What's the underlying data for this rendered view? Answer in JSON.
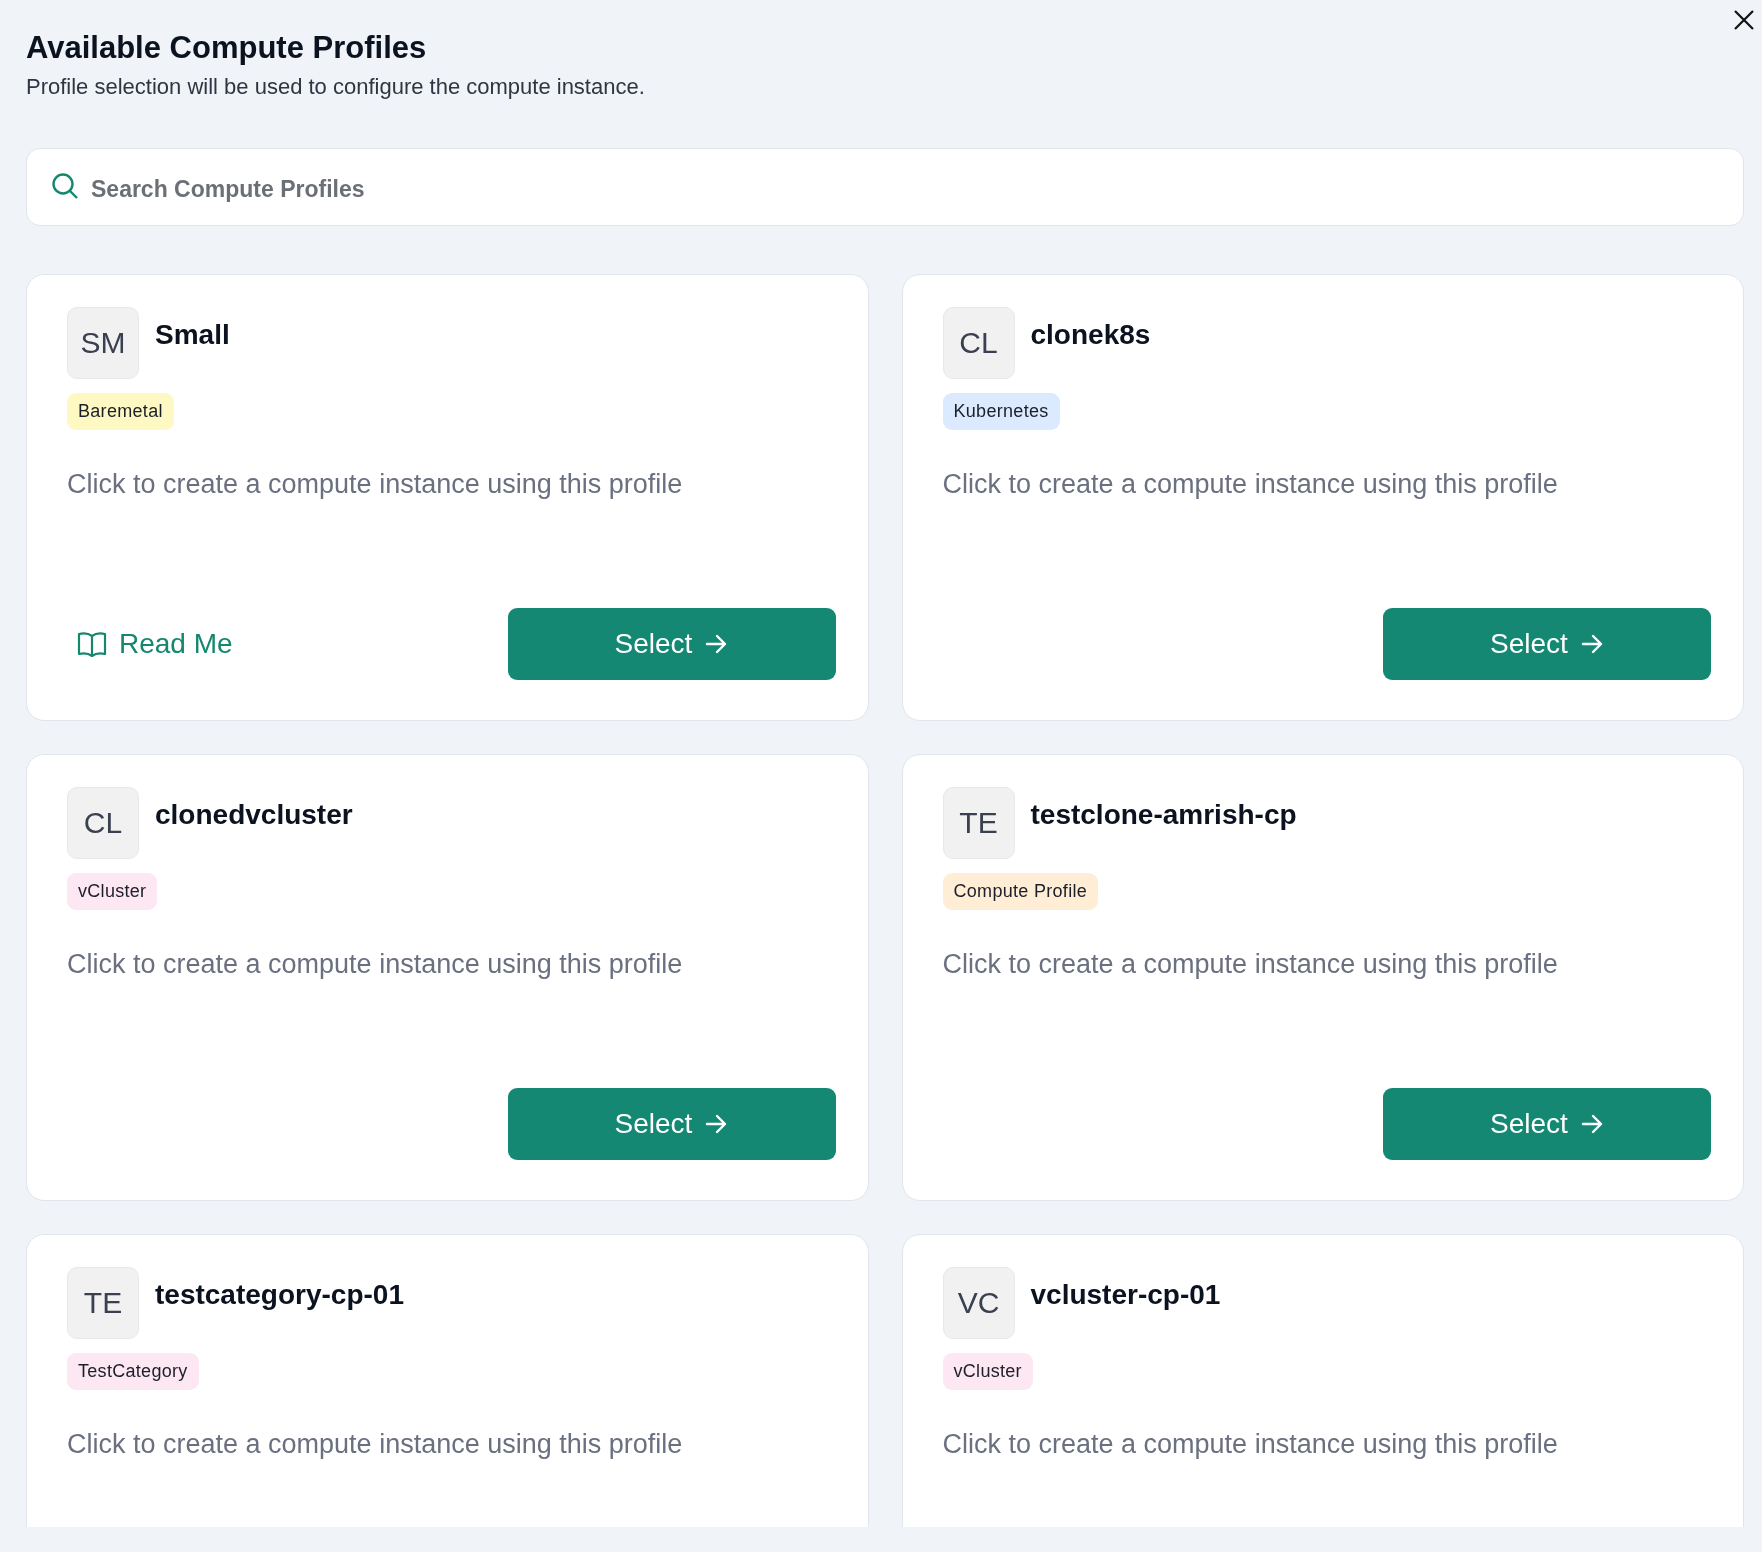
{
  "dialog": {
    "title": "Available Compute Profiles",
    "subtitle": "Profile selection will be used to configure the compute instance."
  },
  "search": {
    "placeholder": "Search Compute Profiles"
  },
  "profiles": [
    {
      "initials": "SM",
      "name": "Small",
      "tag": {
        "label": "Baremetal",
        "color": "#fef9c3"
      },
      "description": "Click to create a compute instance using this profile",
      "readme": "Read Me",
      "select_button": "Select"
    },
    {
      "initials": "CL",
      "name": "clonek8s",
      "tag": {
        "label": "Kubernetes",
        "color": "#dbeafe"
      },
      "description": "Click to create a compute instance using this profile",
      "select_button": "Select"
    },
    {
      "initials": "CL",
      "name": "clonedvcluster",
      "tag": {
        "label": "vCluster",
        "color": "#fce7f3"
      },
      "description": "Click to create a compute instance using this profile",
      "select_button": "Select"
    },
    {
      "initials": "TE",
      "name": "testclone-amrish-cp",
      "tag": {
        "label": "Compute Profile",
        "color": "#ffedd5"
      },
      "description": "Click to create a compute instance using this profile",
      "select_button": "Select"
    },
    {
      "initials": "TE",
      "name": "testcategory-cp-01",
      "tag": {
        "label": "TestCategory",
        "color": "#fce7f3"
      },
      "description": "Click to create a compute instance using this profile"
    },
    {
      "initials": "VC",
      "name": "vcluster-cp-01",
      "tag": {
        "label": "vCluster",
        "color": "#fce7f3"
      },
      "description": "Click to create a compute instance using this profile"
    }
  ]
}
